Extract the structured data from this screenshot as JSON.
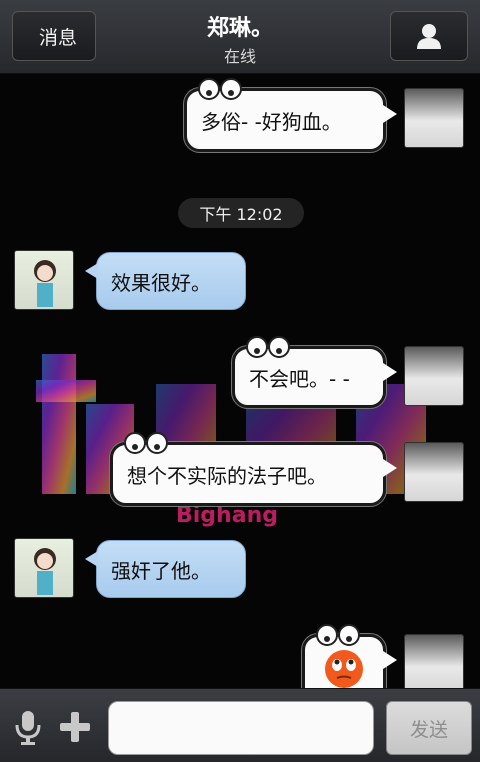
{
  "header": {
    "back_label": "消息",
    "title": "郑琳。",
    "status": "在线",
    "profile_icon": "person-icon"
  },
  "chat": {
    "timestamp": "下午 12:02",
    "background_logo_text": "Bighang",
    "messages": [
      {
        "side": "self",
        "text": "多俗- -好狗血。"
      },
      {
        "side": "other",
        "text": "效果很好。"
      },
      {
        "side": "self",
        "text": "不会吧。- -"
      },
      {
        "side": "self",
        "text": "想个不实际的法子吧。"
      },
      {
        "side": "other",
        "text": "强奸了他。"
      },
      {
        "side": "self",
        "emoji": "rolling-eyes-emoji"
      }
    ]
  },
  "footer": {
    "input_value": "",
    "send_label": "发送",
    "mic_icon": "microphone-icon",
    "plus_icon": "plus-icon"
  },
  "colors": {
    "header_bg": "#2f3236",
    "bubble_other": "#b7d5f2",
    "bubble_self": "#fbfbfb"
  }
}
